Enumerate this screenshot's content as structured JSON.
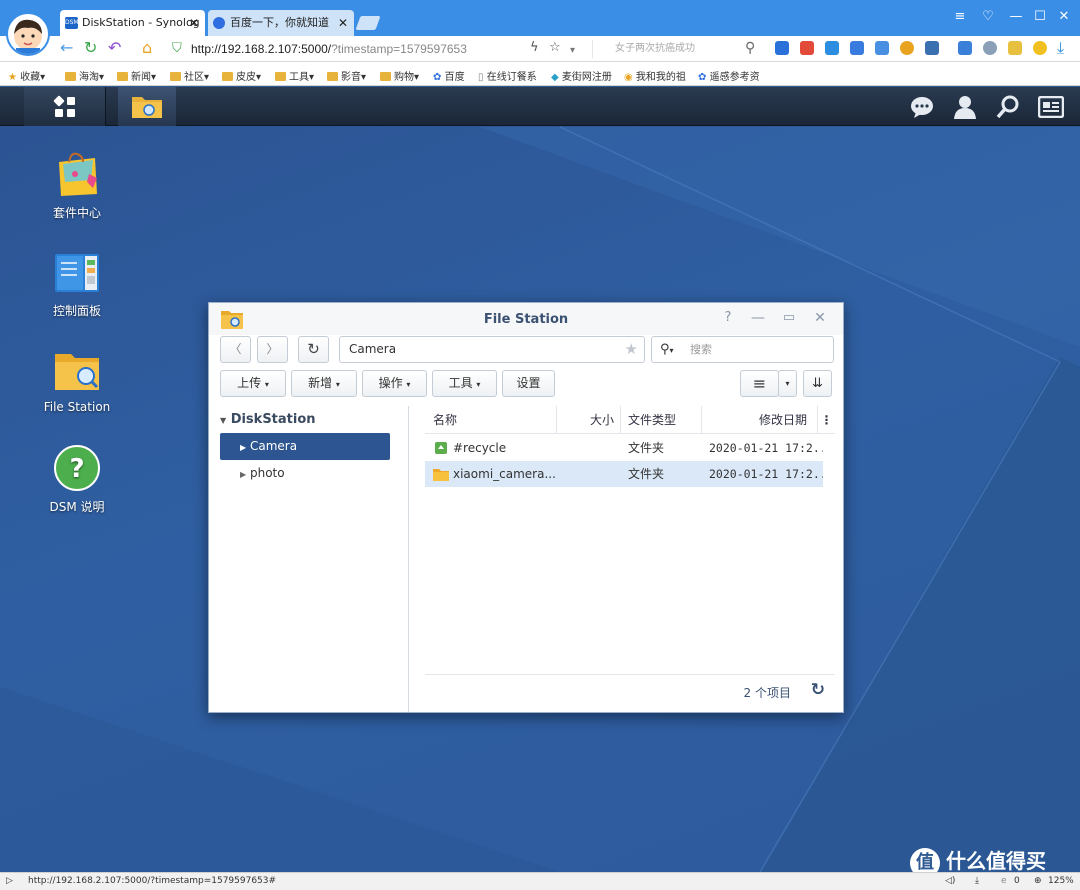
{
  "browser": {
    "tabs": [
      {
        "label": "DiskStation - Synolog",
        "fav": "DSM"
      },
      {
        "label": "百度一下，你就知道"
      }
    ],
    "url_host": "http://192.168.2.107:5000/",
    "url_path": "?timestamp=1579597653",
    "search_placeholder": "女子两次抗癌成功",
    "bookmarks": [
      "收藏",
      "海淘",
      "新闻",
      "社区",
      "皮皮",
      "工具",
      "影音",
      "购物",
      "百度",
      "在线订餐系",
      "麦街网注册",
      "我和我的祖",
      "遥感参考资"
    ],
    "status_url": "http://192.168.2.107:5000/?timestamp=1579597653#",
    "status_count": "0",
    "zoom": "125%"
  },
  "desktop": {
    "icons": [
      {
        "label": "套件中心"
      },
      {
        "label": "控制面板"
      },
      {
        "label": "File Station"
      },
      {
        "label": "DSM 说明"
      }
    ]
  },
  "filestation": {
    "title": "File Station",
    "path": "Camera",
    "search_placeholder": "搜索",
    "toolbar": {
      "upload": "上传",
      "create": "新增",
      "action": "操作",
      "tools": "工具",
      "settings": "设置"
    },
    "tree": {
      "root": "DiskStation",
      "items": [
        "Camera",
        "photo"
      ],
      "selected": "Camera"
    },
    "columns": {
      "name": "名称",
      "size": "大小",
      "type": "文件类型",
      "modified": "修改日期"
    },
    "files": [
      {
        "name": "#recycle",
        "size": "",
        "type": "文件夹",
        "modified": "2020-01-21 17:2...",
        "icon": "recycle-bin-icon"
      },
      {
        "name": "xiaomi_camera...",
        "size": "",
        "type": "文件夹",
        "modified": "2020-01-21 17:2...",
        "icon": "folder-icon"
      }
    ],
    "item_count": "2 个项目"
  },
  "watermark": "什么值得买",
  "colors": {
    "browser_blue": "#3a8ee6",
    "dsm_bar": "#1b2738",
    "tree_selected": "#2c5591",
    "row_selected": "#dbe8f7"
  }
}
